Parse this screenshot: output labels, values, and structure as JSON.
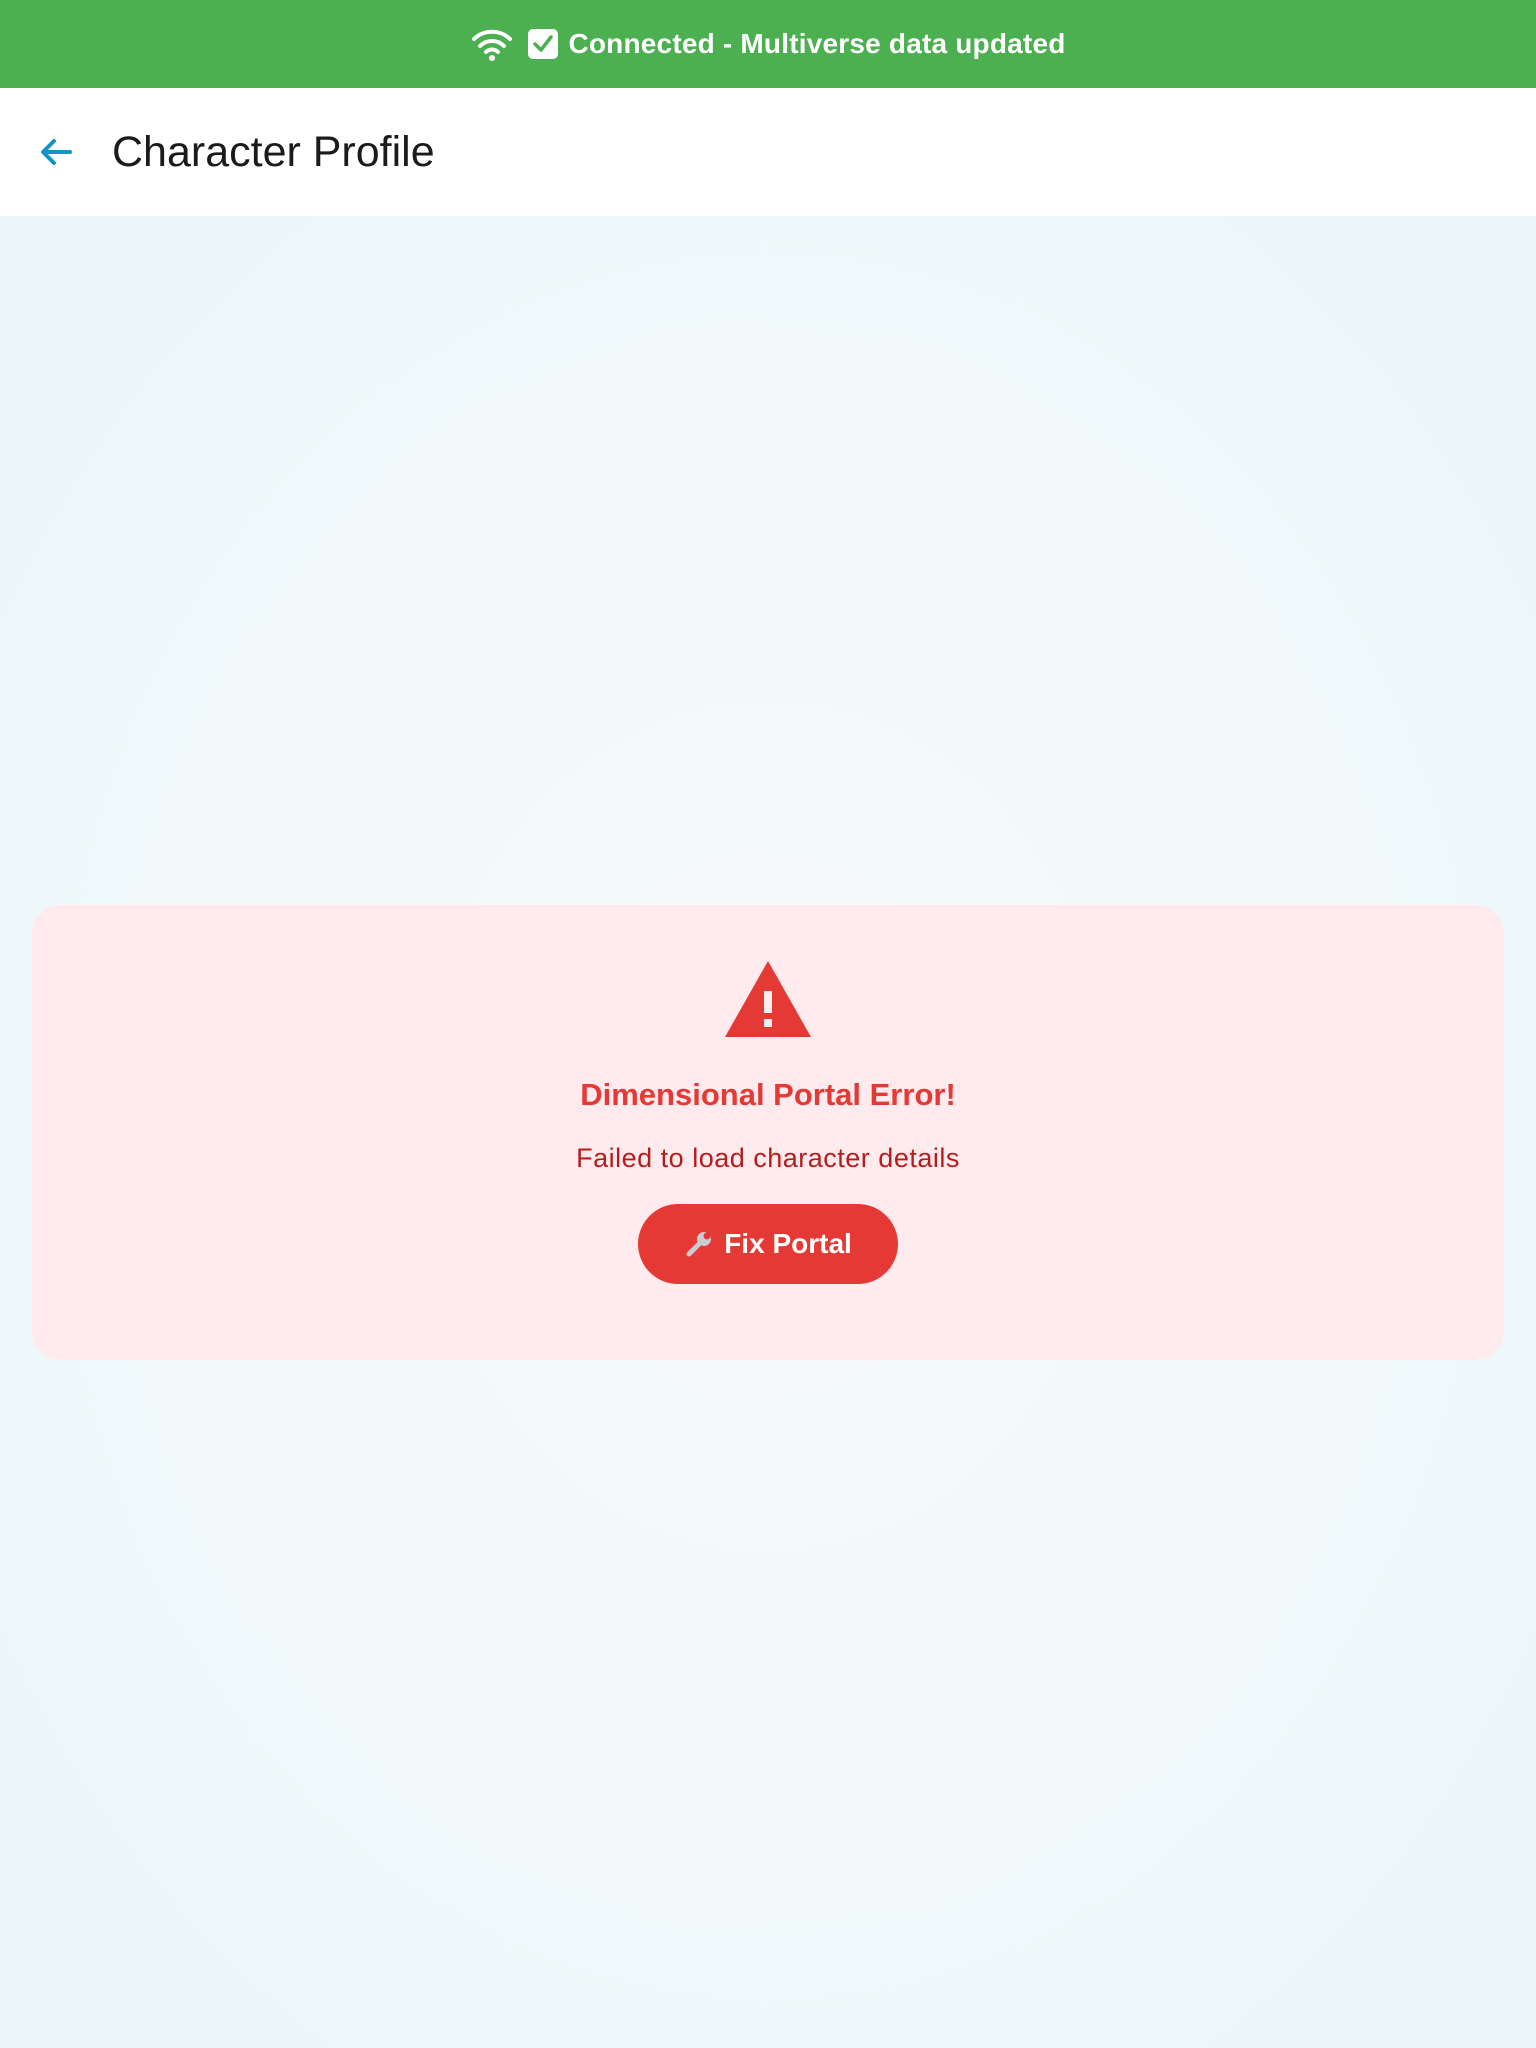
{
  "status_banner": {
    "message": "Connected - Multiverse data updated",
    "wifi_icon": "wifi-icon",
    "check_icon": "check-mark-button-icon",
    "background": "#4caf50"
  },
  "app_bar": {
    "title": "Character Profile",
    "back_icon": "arrow-left-icon",
    "back_icon_color": "#1493c7"
  },
  "error_card": {
    "icon": "warning-icon",
    "title": "Dimensional Portal Error!",
    "message": "Failed to load character details",
    "button_label": "Fix Portal",
    "button_icon": "wrench-icon",
    "accent": "#e53935",
    "background": "#ffebee"
  }
}
